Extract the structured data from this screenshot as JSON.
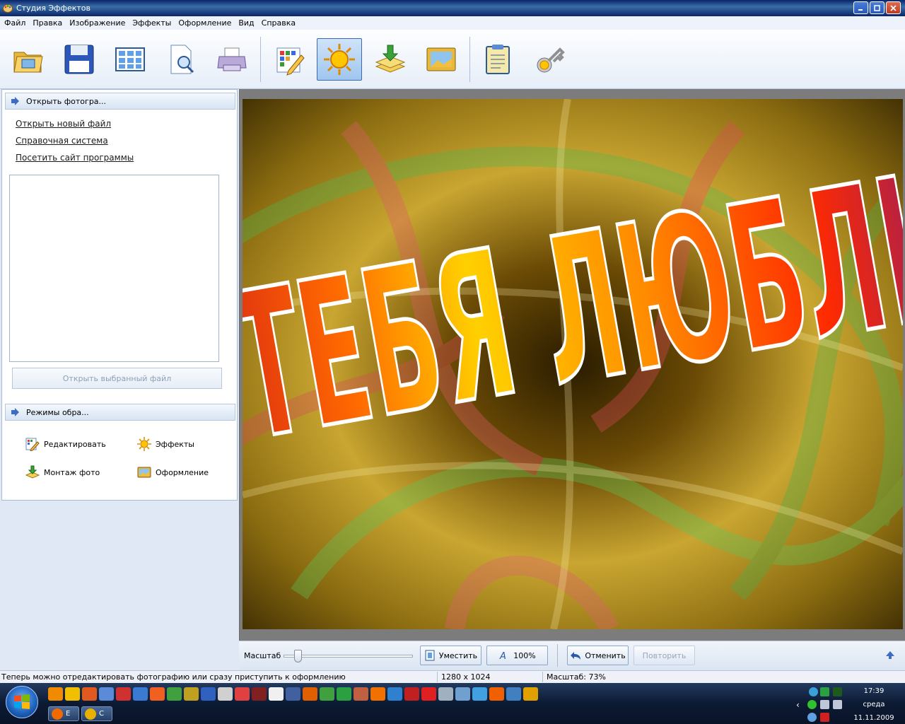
{
  "window": {
    "title": "Студия Эффектов",
    "buttons": [
      "minimize",
      "maximize",
      "close"
    ]
  },
  "menu": [
    "Файл",
    "Правка",
    "Изображение",
    "Эффекты",
    "Оформление",
    "Вид",
    "Справка"
  ],
  "toolbar": {
    "icons": [
      "open-folder-icon",
      "save-icon",
      "grid-icon",
      "preview-icon",
      "print-icon",
      "edit-icon",
      "effects-sun-icon",
      "montage-icon",
      "frame-icon",
      "clipboard-icon",
      "key-icon"
    ],
    "active": "effects-sun-icon"
  },
  "left_panel": {
    "section1_title": "Открыть фотогра...",
    "links": [
      "Открыть новый файл",
      "Справочная система",
      "Посетить сайт программы"
    ],
    "open_selected_label": "Открыть выбранный файл",
    "section2_title": "Режимы обра...",
    "modes": [
      {
        "label": "Редактировать",
        "icon": "edit-icon"
      },
      {
        "label": "Эффекты",
        "icon": "sun-icon"
      },
      {
        "label": "Монтаж фото",
        "icon": "montage-icon"
      },
      {
        "label": "Оформление",
        "icon": "frame-icon"
      }
    ]
  },
  "canvas": {
    "text": "Я ТЕБЯ ЛЮБЛЮ"
  },
  "zoombar": {
    "label": "Масштаб",
    "slider_fraction": 0.09,
    "fit_label": "Уместить",
    "hundred_label": "100%",
    "undo_label": "Отменить",
    "redo_label": "Повторить"
  },
  "status": {
    "message": "Теперь можно отредактировать фотографию или сразу приступить к оформлению",
    "dimensions": "1280 x 1024",
    "zoom": "Масштаб: 73%"
  },
  "taskbar": {
    "quicklaunch_colors": [
      "#f08a00",
      "#f0c000",
      "#e05a20",
      "#5a8ad8",
      "#d03030",
      "#3a7ad0",
      "#f06020",
      "#40a040",
      "#c0a020",
      "#3060c0",
      "#d0d0d0",
      "#e04040",
      "#802020",
      "#f0f0f0",
      "#4060a0",
      "#e06000",
      "#40a040",
      "#2aa040",
      "#c06040",
      "#f07000",
      "#3080d0",
      "#c02020",
      "#e02020",
      "#a0b0c0",
      "#70a0d0",
      "#40a0e0",
      "#f06000",
      "#4080c0",
      "#e0a000"
    ],
    "tasks": [
      {
        "label": "Е",
        "color": "#f06a00"
      },
      {
        "label": "С",
        "color": "#e8b000"
      }
    ],
    "clock": {
      "time": "17:39",
      "day": "среда",
      "date": "11.11.2009"
    }
  }
}
